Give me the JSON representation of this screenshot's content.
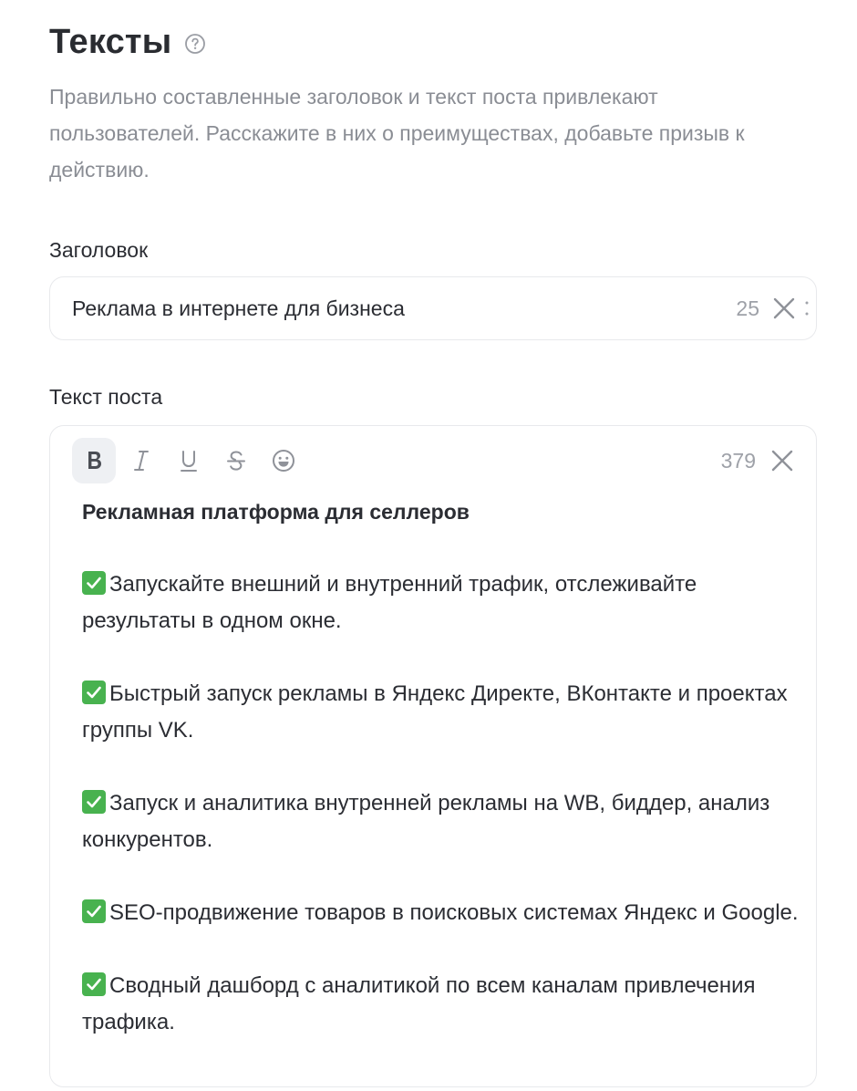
{
  "section": {
    "title": "Тексты",
    "description": "Правильно составленные заголовок и текст поста привлекают пользователей. Расскажите в них о преимуществах, добавьте призыв к действию.",
    "help_icon": "question-circle-icon"
  },
  "title_field": {
    "label": "Заголовок",
    "value": "Реклама в интернете для бизнеса",
    "counter": "25",
    "clear_icon": "close-icon"
  },
  "post_field": {
    "label": "Текст поста",
    "counter": "379",
    "toolbar": [
      {
        "name": "bold",
        "icon": "bold-icon",
        "active": true
      },
      {
        "name": "italic",
        "icon": "italic-icon",
        "active": false
      },
      {
        "name": "underline",
        "icon": "underline-icon",
        "active": false
      },
      {
        "name": "strikethrough",
        "icon": "strikethrough-icon",
        "active": false
      },
      {
        "name": "emoji",
        "icon": "emoji-icon",
        "active": false
      }
    ],
    "heading": "Рекламная платформа для селлеров",
    "bullets": [
      "Запускайте внешний и внутренний трафик, отслеживайте результаты в одном окне.",
      "Быстрый запуск рекламы в Яндекс Директе, ВКонтакте и проектах группы VK.",
      "Запуск и аналитика внутренней рекламы на WB, биддер, анализ конкурентов.",
      "SEO-продвижение товаров в поисковых системах Яндекс и Google.",
      "Сводный дашборд с аналитикой по всем каналам привлечения трафика."
    ],
    "bullet_icon": "check-mark-icon"
  },
  "colors": {
    "text": "#2b2d33",
    "muted": "#8a8d94",
    "border": "#e8e9ec",
    "check_green": "#48b24f"
  }
}
